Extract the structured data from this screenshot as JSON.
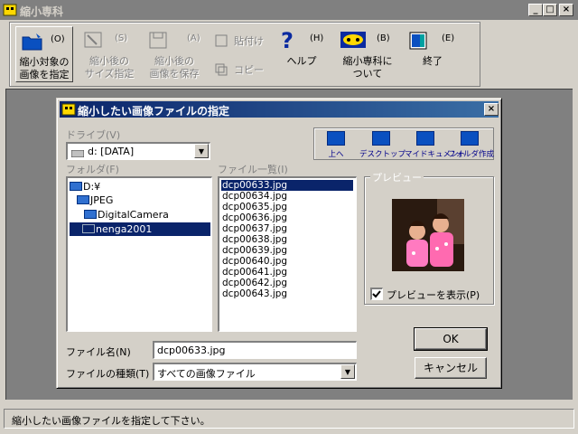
{
  "app": {
    "title": "縮小専科",
    "window_controls": {
      "minimize": "_",
      "maximize": "□",
      "close": "×"
    }
  },
  "toolbar": {
    "items": [
      {
        "label_line1": "縮小対象の",
        "label_line2": "画像を指定",
        "key": "(O)",
        "enabled": true
      },
      {
        "label_line1": "縮小後の",
        "label_line2": "サイズ指定",
        "key": "(S)",
        "enabled": false
      },
      {
        "label_line1": "縮小後の",
        "label_line2": "画像を保存",
        "key": "(A)",
        "enabled": false
      },
      {
        "paste": "貼付け",
        "copy": "コピー",
        "enabled": false
      },
      {
        "label_line1": "ヘルプ",
        "key": "(H)",
        "enabled": true
      },
      {
        "label_line1": "縮小専科に",
        "label_line2": "ついて",
        "key": "(B)",
        "enabled": true
      },
      {
        "label_line1": "終了",
        "key": "(E)",
        "enabled": true
      }
    ]
  },
  "dialog": {
    "title": "縮小したい画像ファイルの指定",
    "close": "×",
    "drive_label": "ドライブ(V)",
    "drive_value": "d: [DATA]",
    "folder_label": "フォルダ(F)",
    "folders": [
      {
        "name": "D:¥",
        "indent": 0,
        "selected": false
      },
      {
        "name": "JPEG",
        "indent": 1,
        "selected": false
      },
      {
        "name": "DigitalCamera",
        "indent": 2,
        "selected": false
      },
      {
        "name": "nenga2001",
        "indent": 3,
        "selected": true
      }
    ],
    "file_list_label": "ファイル一覧(I)",
    "files": [
      "dcp00633.jpg",
      "dcp00634.jpg",
      "dcp00635.jpg",
      "dcp00636.jpg",
      "dcp00637.jpg",
      "dcp00638.jpg",
      "dcp00639.jpg",
      "dcp00640.jpg",
      "dcp00641.jpg",
      "dcp00642.jpg",
      "dcp00643.jpg"
    ],
    "selected_file_index": 0,
    "nav_buttons": [
      "上へ",
      "デスクトップ",
      "マイドキュメント",
      "フォルダ作成"
    ],
    "preview_label": "プレビュー",
    "preview_checkbox": "プレビューを表示(P)",
    "preview_checked": true,
    "filename_label": "ファイル名(N)",
    "filename_value": "dcp00633.jpg",
    "filetype_label": "ファイルの種類(T)",
    "filetype_value": "すべての画像ファイル",
    "ok": "OK",
    "cancel": "キャンセル"
  },
  "status": {
    "text": "縮小したい画像ファイルを指定して下さい。"
  },
  "colors": {
    "titlebar_active": "#0a246a",
    "selection": "#0a246a",
    "face": "#d4d0c8"
  }
}
